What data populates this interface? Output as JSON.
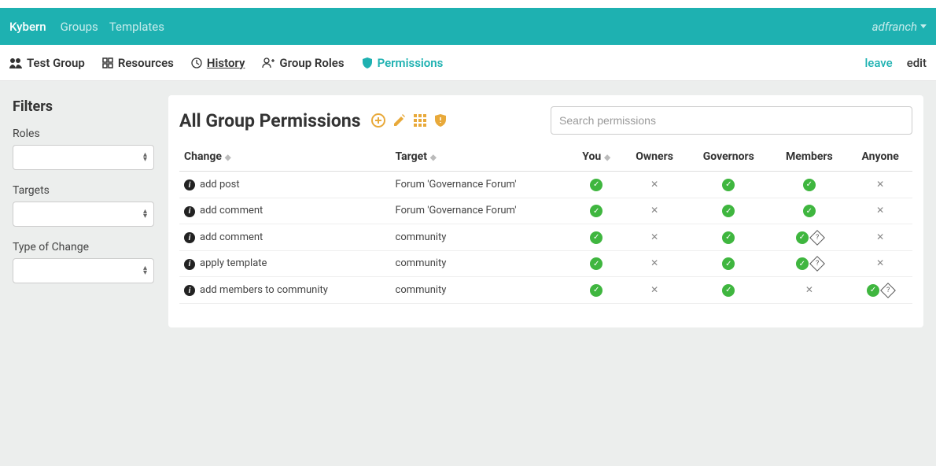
{
  "navbar": {
    "brand": "Kybern",
    "links": [
      "Groups",
      "Templates"
    ],
    "user": "adfranch"
  },
  "subnav": {
    "group_name": "Test Group",
    "items": [
      {
        "label": "Resources"
      },
      {
        "label": "History"
      },
      {
        "label": "Group Roles"
      },
      {
        "label": "Permissions",
        "active": true
      }
    ],
    "leave": "leave",
    "edit": "edit"
  },
  "filters": {
    "heading": "Filters",
    "roles_label": "Roles",
    "targets_label": "Targets",
    "type_label": "Type of Change"
  },
  "panel": {
    "title": "All Group Permissions",
    "search_placeholder": "Search permissions"
  },
  "columns": {
    "change": "Change",
    "target": "Target",
    "you": "You",
    "owners": "Owners",
    "governors": "Governors",
    "members": "Members",
    "anyone": "Anyone"
  },
  "rows": [
    {
      "change": "add post",
      "target": "Forum 'Governance Forum'",
      "you": "check",
      "owners": "cross",
      "governors": "check",
      "members": "check",
      "anyone": "cross"
    },
    {
      "change": "add comment",
      "target": "Forum 'Governance Forum'",
      "you": "check",
      "owners": "cross",
      "governors": "check",
      "members": "check",
      "anyone": "cross"
    },
    {
      "change": "add comment",
      "target": "community",
      "you": "check",
      "owners": "cross",
      "governors": "check",
      "members": "check-cond",
      "anyone": "cross"
    },
    {
      "change": "apply template",
      "target": "community",
      "you": "check",
      "owners": "cross",
      "governors": "check",
      "members": "check-cond",
      "anyone": "cross"
    },
    {
      "change": "add members to community",
      "target": "community",
      "you": "check",
      "owners": "cross",
      "governors": "check",
      "members": "cross",
      "anyone": "check-cond"
    }
  ]
}
